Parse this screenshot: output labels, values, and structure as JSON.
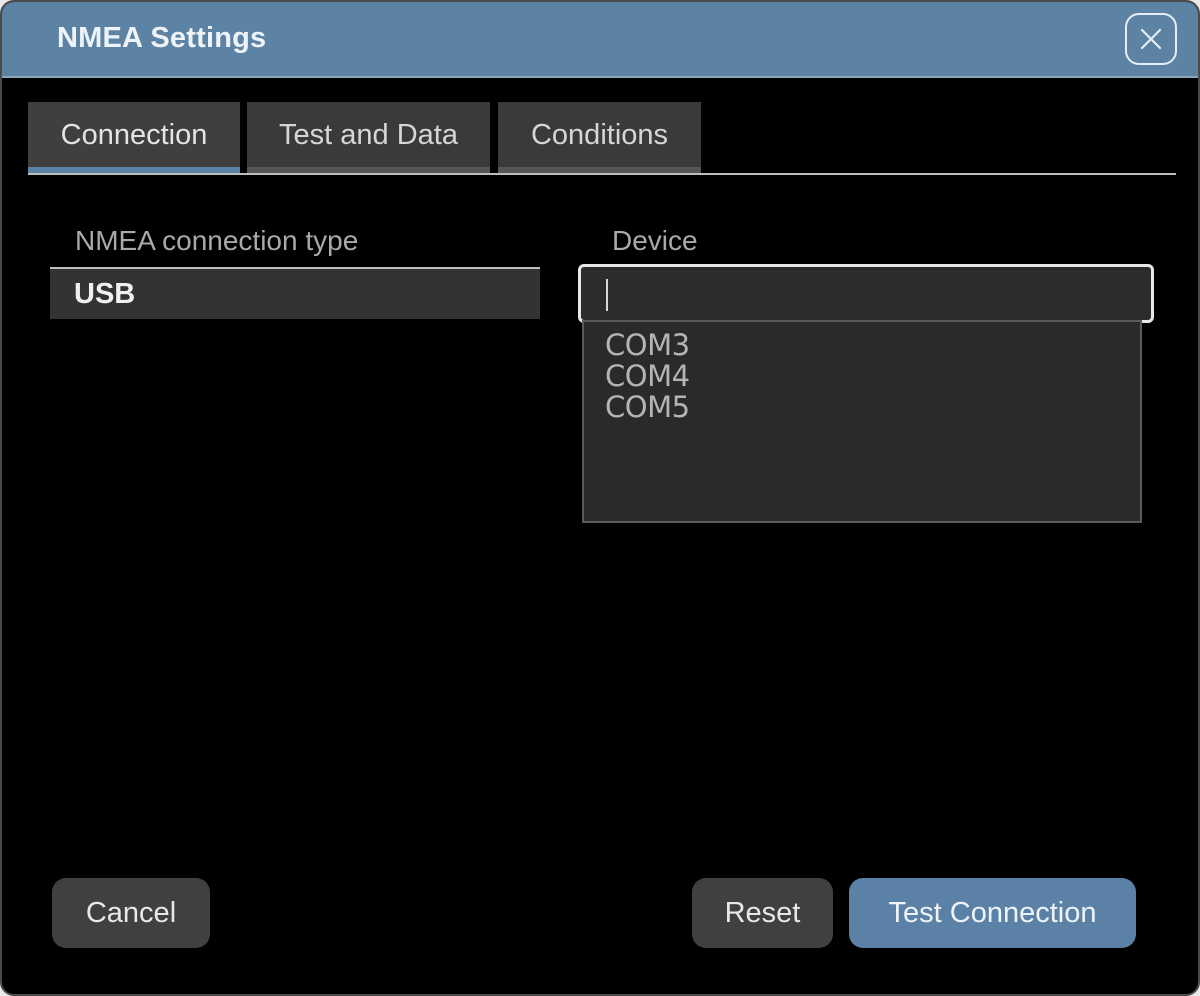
{
  "window": {
    "title": "NMEA Settings",
    "close_icon": "close-icon"
  },
  "tabs": [
    {
      "label": "Connection",
      "active": true
    },
    {
      "label": "Test and Data",
      "active": false
    },
    {
      "label": "Conditions",
      "active": false
    }
  ],
  "connection": {
    "type_label": "NMEA connection type",
    "type_value": "USB",
    "device_label": "Device",
    "device_value": "",
    "device_options": [
      "COM3",
      "COM4",
      "COM5"
    ]
  },
  "buttons": {
    "cancel": "Cancel",
    "reset": "Reset",
    "test_connection": "Test Connection"
  },
  "colors": {
    "accent": "#5b82a6",
    "background": "#000000",
    "button": "#404040"
  }
}
